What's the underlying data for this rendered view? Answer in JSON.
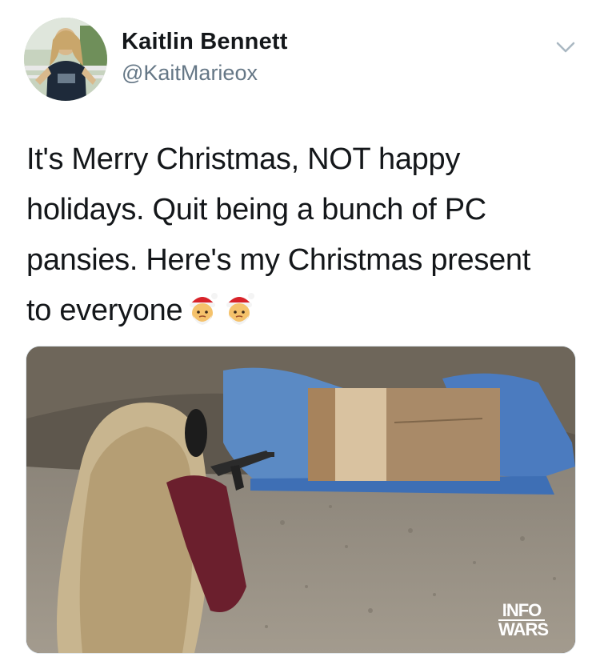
{
  "tweet": {
    "display_name": "Kaitlin Bennett",
    "handle": "@KaitMarieox",
    "text_lines": [
      "It's Merry Christmas, NOT happy",
      "holidays. Quit being a bunch of PC",
      "pansies. Here's my Christmas present",
      "to everyone"
    ],
    "emojis": [
      "santa-emoji",
      "santa-emoji"
    ]
  },
  "media": {
    "watermark_line1": "INFO",
    "watermark_line2": "WARS"
  },
  "icons": {
    "menu": "chevron-down-icon"
  },
  "colors": {
    "name": "#14171a",
    "handle": "#657786",
    "caret": "#aab8c2"
  }
}
